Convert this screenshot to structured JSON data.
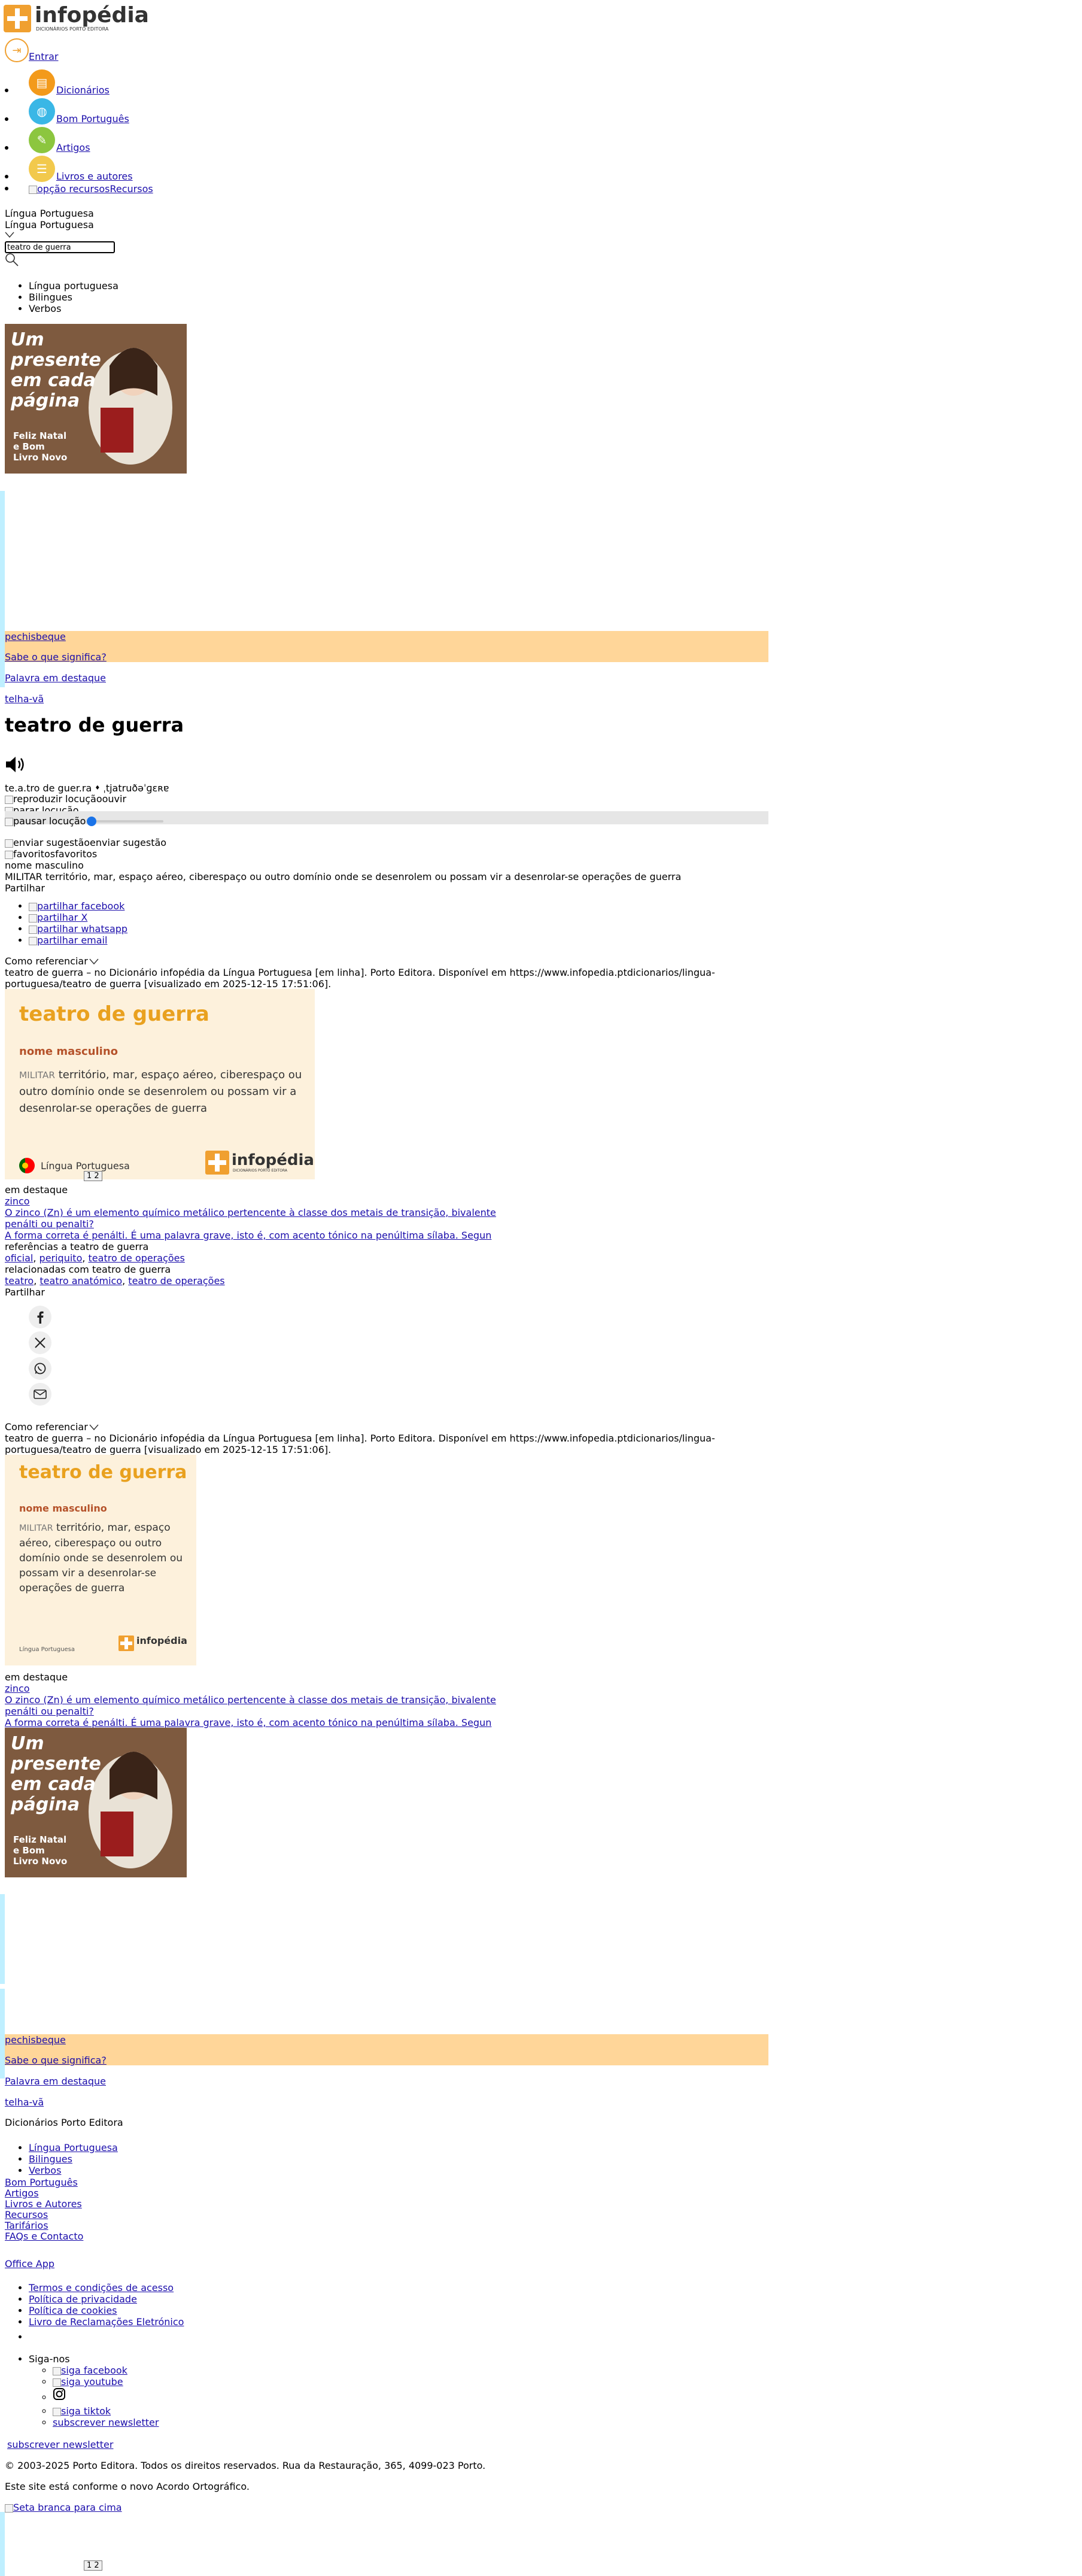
{
  "brand": {
    "name": "infopédia",
    "tagline": "DICIONÁRIOS PORTO EDITORA",
    "accent": "#f0a030"
  },
  "header": {
    "login_label": "Entrar",
    "nav": [
      {
        "label": "Dicionários",
        "icon": "book-icon",
        "color": "#f39a1b"
      },
      {
        "label": "Bom Português",
        "icon": "globe-icon",
        "color": "#3ab7e6"
      },
      {
        "label": "Artigos",
        "icon": "article-icon",
        "color": "#8cc63f"
      },
      {
        "label": "Livros e autores",
        "icon": "books-icon",
        "color": "#f2c94c"
      }
    ],
    "resources_alt": "opção recursos",
    "resources_label": "Recursos"
  },
  "search": {
    "language_selected": "Língua Portuguesa",
    "language_selected_repeat": "Língua Portuguesa",
    "query": "teatro de guerra",
    "types": [
      "Língua portuguesa",
      "Bilingues",
      "Verbos"
    ]
  },
  "ad": {
    "headline": "Um presente em cada página",
    "subline": "Feliz Natal e Bom Livro Novo"
  },
  "promo": {
    "word1": "pechisbeque",
    "question": "Sabe o que significa?",
    "featured_label": "Palavra em destaque",
    "word2": "telha-vã"
  },
  "entry": {
    "headword": "teatro de guerra",
    "syllables": "te.a.tro de guer.ra",
    "ipa": "ˌtjatruðəˈɡɛʀɐ",
    "play_alt": "reproduzir locução",
    "play_label": "ouvir",
    "stop_alt": "parar locução",
    "pause_alt": "pausar locução",
    "suggest_alt": "enviar sugestão",
    "suggest_label": "enviar sugestão",
    "fav_alt": "favoritos",
    "fav_label": "favoritos",
    "pos": "nome masculino",
    "domain": "MILITAR",
    "definition": "território, mar, espaço aéreo, ciberespaço ou outro domínio onde se desenrolem ou possam vir a desenrolar-se operações de guerra",
    "share_label": "Partilhar",
    "share": [
      "partilhar facebook",
      "partilhar X",
      "partilhar whatsapp",
      "partilhar email"
    ],
    "cite_label": "Como referenciar",
    "citation": "teatro de guerra – no Dicionário infopédia da Língua Portuguesa [em linha]. Porto Editora. Disponível em https://www.infopedia.ptdicionarios/lingua-portuguesa/teatro de guerra [visualizado em 2025-12-15 17:51:06].",
    "card_language": "Língua Portuguesa",
    "pager": "1 2"
  },
  "highlights": {
    "label": "em destaque",
    "items": [
      "zinco",
      "O zinco (Zn) é um elemento químico metálico pertencente à classe dos metais de transição, bivalente",
      "penálti ou penalti?",
      "A forma correta é penálti. É uma palavra grave, isto é, com acento tónico na penúltima sílaba. Segun"
    ]
  },
  "references": {
    "label": "referências a teatro de guerra",
    "items": [
      "oficial",
      "periquito",
      "teatro de operações"
    ]
  },
  "related": {
    "label": "relacionadas com teatro de guerra",
    "items": [
      "teatro",
      "teatro anatómico",
      "teatro de operações"
    ]
  },
  "footer": {
    "title": "Dicionários Porto Editora",
    "dict_links": [
      "Língua Portuguesa",
      "Bilingues",
      "Verbos"
    ],
    "links": [
      "Bom Português",
      "Artigos",
      "Livros e Autores",
      "Recursos",
      "Tarifários",
      "FAQs e Contacto"
    ],
    "office": "Office App",
    "legal": [
      "Termos e condições de acesso",
      "Política de privacidade",
      "Política de cookies",
      "Livro de Reclamações Eletrónico"
    ],
    "follow_label": "Siga-nos",
    "follow": [
      "siga facebook",
      "siga youtube",
      "",
      "siga tiktok",
      "subscrever newsletter"
    ],
    "newsletter": "subscrever newsletter",
    "copyright": "© 2003-2025 Porto Editora. Todos os direitos reservados. Rua da Restauração, 365, 4099-023 Porto.",
    "ao": "Este site está conforme o novo Acordo Ortográfico.",
    "top_alt": "Seta branca para cima",
    "pager": "1 2"
  }
}
